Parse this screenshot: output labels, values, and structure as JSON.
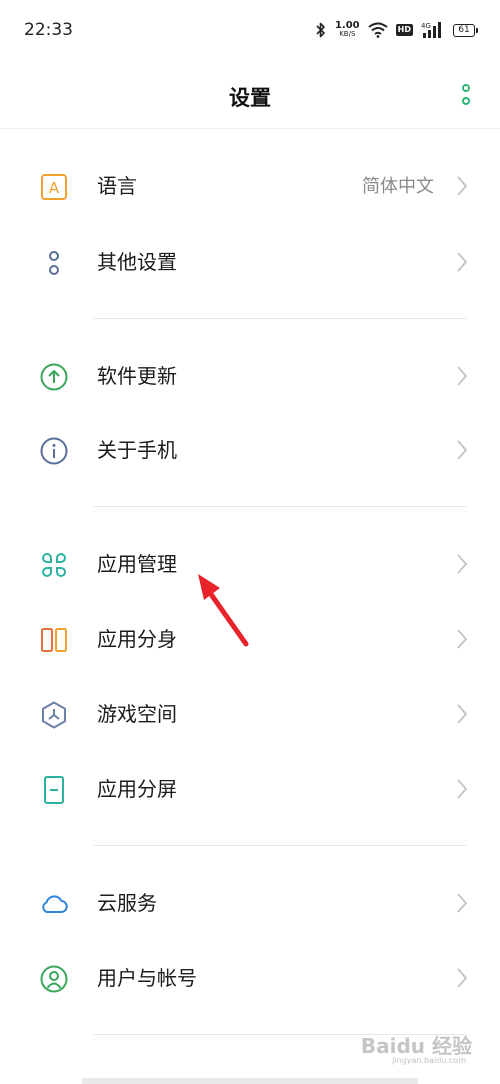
{
  "status_bar": {
    "time": "22:33",
    "net_speed_value": "1.00",
    "net_speed_unit": "KB/S",
    "hd": "HD",
    "signal_type": "4G",
    "battery": "61"
  },
  "header": {
    "title": "设置"
  },
  "groups": [
    [
      {
        "label": "语言",
        "value": "简体中文",
        "icon": "language-icon"
      },
      {
        "label": "其他设置",
        "icon": "other-settings-icon"
      }
    ],
    [
      {
        "label": "软件更新",
        "icon": "update-icon"
      },
      {
        "label": "关于手机",
        "icon": "info-icon"
      }
    ],
    [
      {
        "label": "应用管理",
        "icon": "app-management-icon"
      },
      {
        "label": "应用分身",
        "icon": "app-clone-icon"
      },
      {
        "label": "游戏空间",
        "icon": "game-space-icon"
      },
      {
        "label": "应用分屏",
        "icon": "split-screen-icon"
      }
    ],
    [
      {
        "label": "云服务",
        "icon": "cloud-icon"
      },
      {
        "label": "用户与帐号",
        "icon": "user-account-icon"
      }
    ]
  ],
  "language_icon_letter": "A",
  "watermark": {
    "text": "Baidu 经验",
    "sub": "jingyan.baidu.com"
  },
  "colors": {
    "accent_green": "#2bb673",
    "annotation_red": "#e8232a"
  }
}
